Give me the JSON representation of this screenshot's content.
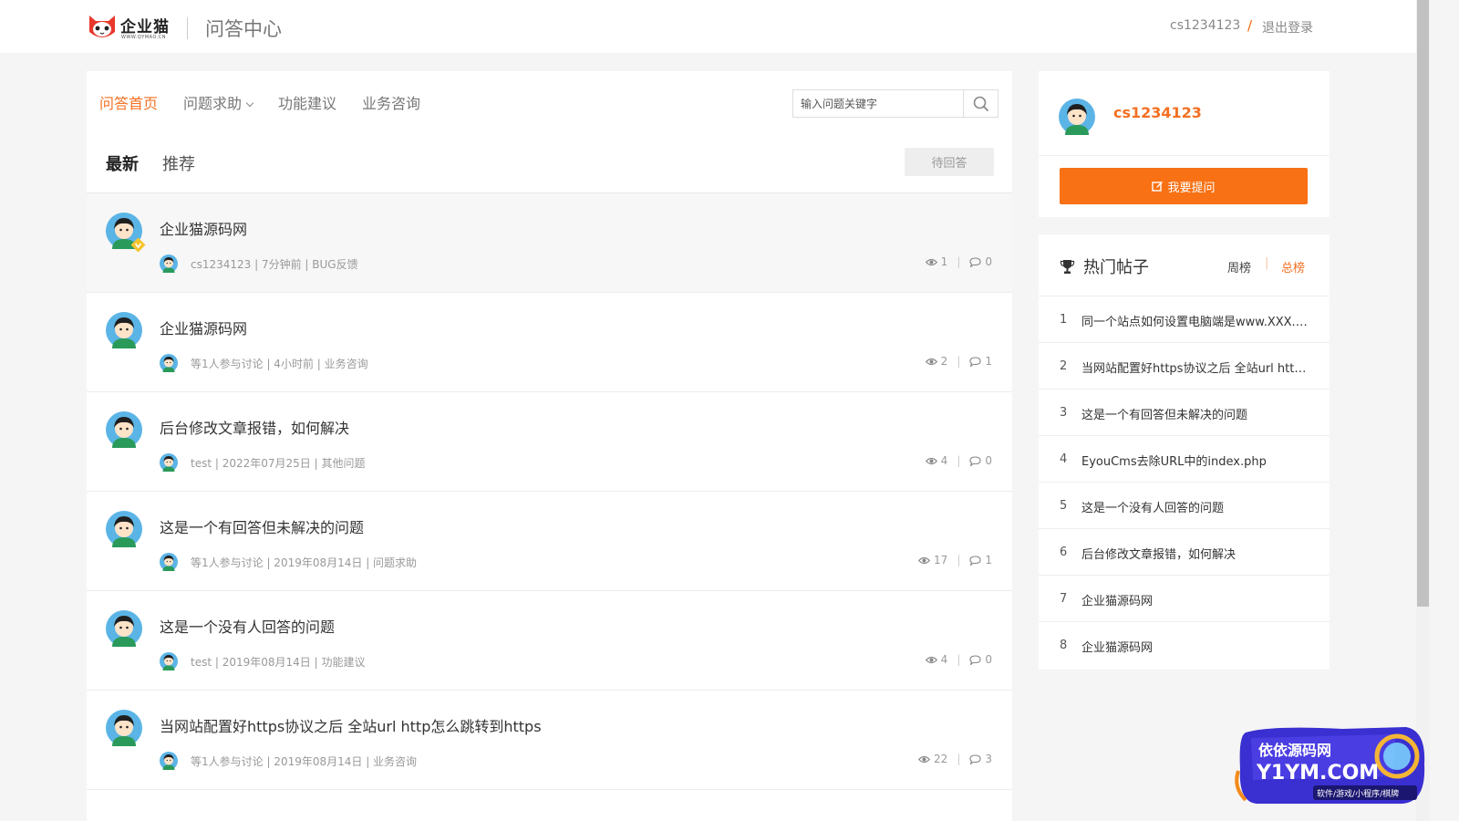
{
  "header": {
    "logo_text": "企业猫",
    "logo_sub": "WWW.QYMAO.CN",
    "site_title": "问答中心",
    "username": "cs1234123",
    "separator": "/",
    "logout_label": "退出登录"
  },
  "nav": {
    "items": [
      {
        "label": "问答首页",
        "active": true
      },
      {
        "label": "问题求助",
        "dropdown": true
      },
      {
        "label": "功能建议"
      },
      {
        "label": "业务咨询"
      }
    ]
  },
  "search": {
    "placeholder": "输入问题关键字",
    "icon": "search-icon"
  },
  "tabs": [
    {
      "label": "最新",
      "active": true
    },
    {
      "label": "推荐"
    }
  ],
  "pending_button": "待回答",
  "questions": [
    {
      "title": "企业猫源码网",
      "meta": "cs1234123 | 7分钟前 | BUG反馈",
      "views": "1",
      "replies": "0",
      "sep": "|",
      "badge": true
    },
    {
      "title": "企业猫源码网",
      "meta": "等1人参与讨论 | 4小时前 | 业务咨询",
      "views": "2",
      "replies": "1",
      "sep": "|"
    },
    {
      "title": "后台修改文章报错，如何解决",
      "meta": "test | 2022年07月25日 | 其他问题",
      "views": "4",
      "replies": "0",
      "sep": "|"
    },
    {
      "title": "这是一个有回答但未解决的问题",
      "meta": "等1人参与讨论 | 2019年08月14日 | 问题求助",
      "views": "17",
      "replies": "1",
      "sep": "|"
    },
    {
      "title": "这是一个没有人回答的问题",
      "meta": "test | 2019年08月14日 | 功能建议",
      "views": "4",
      "replies": "0",
      "sep": "|"
    },
    {
      "title": "当网站配置好https协议之后 全站url http怎么跳转到https",
      "meta": "等1人参与讨论 | 2019年08月14日 | 业务咨询",
      "views": "22",
      "replies": "3",
      "sep": "|"
    }
  ],
  "user_card": {
    "name": "cs1234123",
    "ask_label": "我要提问"
  },
  "hot": {
    "title": "热门帖子",
    "tab_week": "周榜",
    "tab_sep": "|",
    "tab_all": "总榜",
    "items": [
      {
        "num": "1",
        "text": "同一个站点如何设置电脑端是www.XXX.com"
      },
      {
        "num": "2",
        "text": "当网站配置好https协议之后 全站url http怎么跳转到https"
      },
      {
        "num": "3",
        "text": "这是一个有回答但未解决的问题"
      },
      {
        "num": "4",
        "text": "EyouCms去除URL中的index.php"
      },
      {
        "num": "5",
        "text": "这是一个没有人回答的问题"
      },
      {
        "num": "6",
        "text": "后台修改文章报错，如何解决"
      },
      {
        "num": "7",
        "text": "企业猫源码网"
      },
      {
        "num": "8",
        "text": "企业猫源码网"
      }
    ]
  },
  "watermark": {
    "line1": "依依源码网",
    "line2": "Y1YM.COM",
    "line3": "软件/游戏/小程序/棋牌"
  },
  "colors": {
    "accent": "#f37022",
    "button": "#f87114",
    "background": "#f5f5f5"
  }
}
